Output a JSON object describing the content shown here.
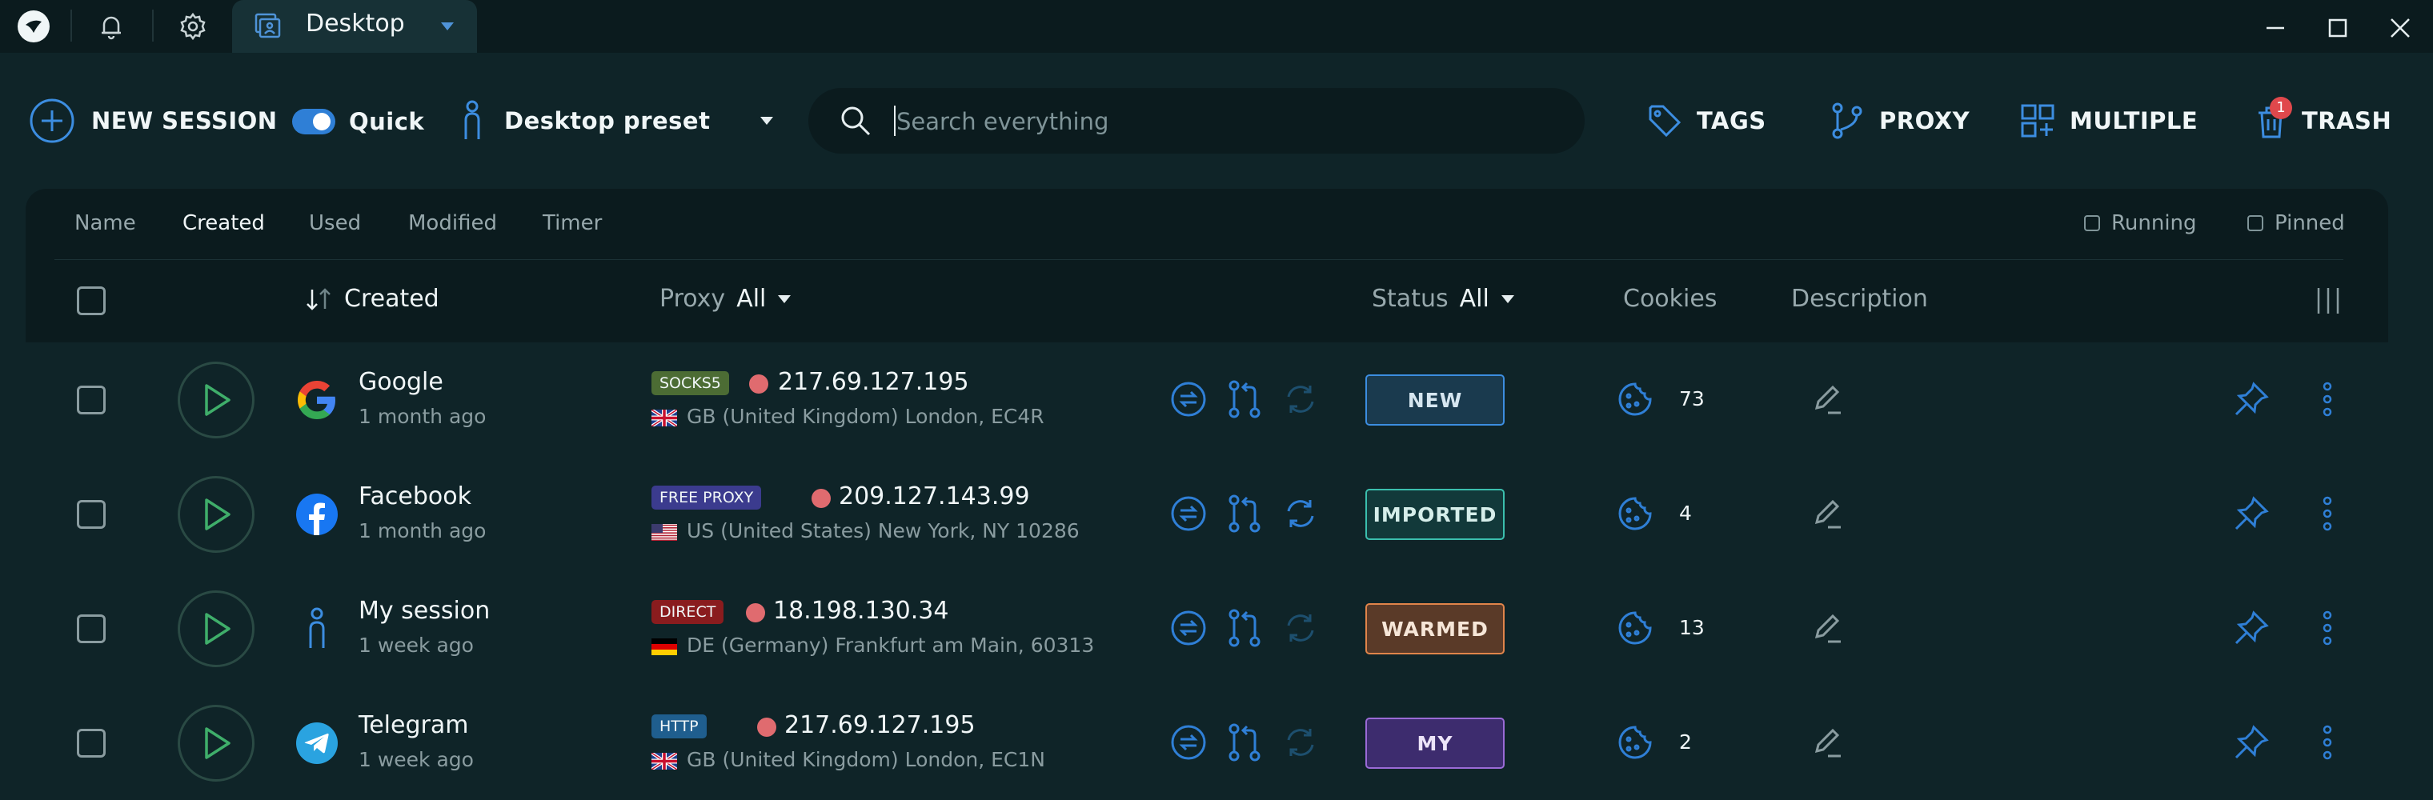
{
  "titlebar": {
    "tab_label": "Desktop",
    "icons": [
      "app-logo-icon",
      "bell-icon",
      "gear-icon",
      "desktop-profile-icon",
      "caret-down-icon",
      "minimize-icon",
      "maximize-icon",
      "close-icon"
    ]
  },
  "toolbar": {
    "new_session_label": "NEW SESSION",
    "quick_label": "Quick",
    "quick_enabled": true,
    "preset_label": "Desktop preset",
    "tags_label": "TAGS",
    "proxy_label": "PROXY",
    "multiple_label": "MULTIPLE",
    "trash_label": "TRASH",
    "trash_badge": "1"
  },
  "search": {
    "placeholder": "Search everything",
    "value": ""
  },
  "sort_tabs": [
    {
      "label": "Name",
      "active": false
    },
    {
      "label": "Created",
      "active": true
    },
    {
      "label": "Used",
      "active": false
    },
    {
      "label": "Modified",
      "active": false
    },
    {
      "label": "Timer",
      "active": false
    }
  ],
  "filters": {
    "running_label": "Running",
    "pinned_label": "Pinned"
  },
  "columns": {
    "created": "Created",
    "proxy": "Proxy",
    "proxy_filter": "All",
    "status": "Status",
    "status_filter": "All",
    "cookies": "Cookies",
    "description": "Description"
  },
  "colors": {
    "accent": "#3c8de0",
    "play_green": "#3fae6a",
    "background": "#0f2428",
    "panel": "#0b1b1e"
  },
  "rows": [
    {
      "name": "Google",
      "time": "1 month ago",
      "logo": "google-logo-icon",
      "proxy_type": "SOCKS5",
      "proxy_badge_color": "#4c6c34",
      "ip": "217.69.127.195",
      "flag": "gb-flag-icon",
      "location": "GB (United Kingdom) London, EC4R",
      "refresh_active": false,
      "status": "NEW",
      "status_bg": "#1a3a4e",
      "status_border": "#3c8de0",
      "status_text": "#d6e6f0",
      "cookies": "73"
    },
    {
      "name": "Facebook",
      "time": "1 month ago",
      "logo": "facebook-logo-icon",
      "proxy_type": "FREE PROXY",
      "proxy_badge_color": "#3b3b8e",
      "ip": "209.127.143.99",
      "flag": "us-flag-icon",
      "location": "US (United States) New York, NY 10286",
      "refresh_active": true,
      "status": "IMPORTED",
      "status_bg": "#12393a",
      "status_border": "#3bbfae",
      "status_text": "#d6eeea",
      "cookies": "4"
    },
    {
      "name": "My session",
      "time": "1 week ago",
      "logo": "person-icon",
      "proxy_type": "DIRECT",
      "proxy_badge_color": "#8a1c1e",
      "ip": "18.198.130.34",
      "flag": "de-flag-icon",
      "location": "DE (Germany) Frankfurt am Main, 60313",
      "refresh_active": false,
      "status": "WARMED",
      "status_bg": "#5a3a28",
      "status_border": "#e0844a",
      "status_text": "#f6e6d8",
      "cookies": "13"
    },
    {
      "name": "Telegram",
      "time": "1 week ago",
      "logo": "telegram-logo-icon",
      "proxy_type": "HTTP",
      "proxy_badge_color": "#1f5e8e",
      "ip": "217.69.127.195",
      "flag": "gb-flag-icon",
      "location": "GB (United Kingdom) London, EC1N",
      "refresh_active": false,
      "status": "MY",
      "status_bg": "#3d2c6e",
      "status_border": "#9a6ad6",
      "status_text": "#ece4f8",
      "cookies": "2"
    }
  ]
}
